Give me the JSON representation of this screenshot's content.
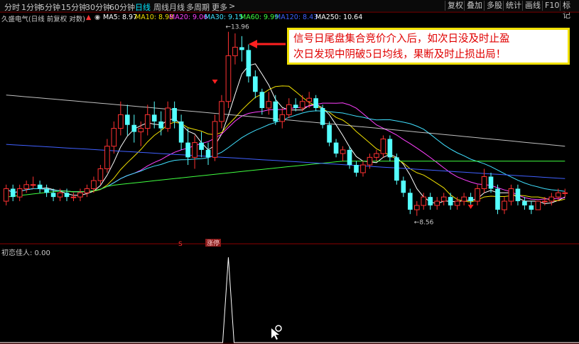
{
  "toolbar": {
    "periods": [
      "分时",
      "1分钟",
      "5分钟",
      "15分钟",
      "30分钟",
      "60分钟",
      "日线",
      "周线",
      "月线",
      "多周期",
      "更多"
    ],
    "active_period": "日线",
    "more_arrow": ">",
    "buttons": [
      "复权",
      "叠加",
      "多股",
      "统计",
      "画线",
      "F10",
      "标记"
    ]
  },
  "stock": {
    "name_line": "久盛电气(日线 前复权 对数)",
    "ma": [
      {
        "label": "MA5: 8.97",
        "color": "#ffffff"
      },
      {
        "label": "MA10: 8.98",
        "color": "#f0e000"
      },
      {
        "label": "MA20: 9.06",
        "color": "#ff40ff"
      },
      {
        "label": "MA30: 9.15",
        "color": "#40e0ff"
      },
      {
        "label": "MA60: 9.99",
        "color": "#40ff40"
      },
      {
        "label": "MA120: 8.43",
        "color": "#4060ff"
      },
      {
        "label": "MA250: 10.64",
        "color": "#ffffff"
      }
    ]
  },
  "annotation": {
    "line1": "信号日尾盘集合竞价介入后，如次日没及时止盈",
    "line2": "次日发现中阴破5日均线，果断及时止损出局！"
  },
  "labels": {
    "high": "13.96",
    "low": "8.56",
    "s_mark": "S",
    "tag": "涨停"
  },
  "indicator": {
    "name": "初恋佳人",
    "value": ": 0.00"
  },
  "colors": {
    "up": "#ff3232",
    "down": "#54ffff",
    "bg": "#000000"
  },
  "chart_data": {
    "type": "candlestick",
    "candles": [
      [
        8.9,
        9.3,
        8.8,
        9.2
      ],
      [
        9.2,
        9.3,
        8.9,
        9.0
      ],
      [
        9.0,
        9.3,
        8.9,
        9.2
      ],
      [
        9.2,
        9.4,
        9.1,
        9.3
      ],
      [
        9.3,
        9.5,
        9.2,
        9.3
      ],
      [
        9.3,
        9.4,
        9.1,
        9.2
      ],
      [
        9.2,
        9.3,
        9.0,
        9.1
      ],
      [
        9.1,
        9.2,
        8.9,
        9.0
      ],
      [
        9.0,
        9.2,
        8.9,
        9.1
      ],
      [
        9.1,
        9.2,
        8.9,
        9.0
      ],
      [
        9.0,
        9.1,
        8.9,
        9.0
      ],
      [
        9.0,
        9.2,
        8.9,
        9.1
      ],
      [
        9.1,
        9.3,
        9.0,
        9.2
      ],
      [
        9.2,
        9.5,
        9.1,
        9.4
      ],
      [
        9.4,
        9.8,
        9.3,
        9.7
      ],
      [
        9.7,
        10.5,
        9.6,
        10.3
      ],
      [
        10.3,
        11.0,
        10.1,
        10.8
      ],
      [
        10.8,
        11.6,
        10.6,
        11.2
      ],
      [
        11.2,
        11.5,
        10.6,
        10.9
      ],
      [
        10.9,
        11.2,
        10.4,
        10.7
      ],
      [
        10.7,
        11.0,
        10.3,
        10.8
      ],
      [
        10.8,
        11.5,
        10.6,
        11.2
      ],
      [
        11.2,
        11.6,
        10.8,
        11.0
      ],
      [
        11.0,
        11.3,
        10.6,
        10.8
      ],
      [
        10.8,
        11.6,
        10.7,
        11.4
      ],
      [
        11.4,
        11.6,
        10.8,
        11.0
      ],
      [
        11.0,
        11.2,
        10.2,
        10.4
      ],
      [
        10.4,
        10.8,
        9.8,
        10.0
      ],
      [
        10.0,
        10.6,
        9.7,
        10.4
      ],
      [
        10.4,
        10.7,
        10.0,
        10.2
      ],
      [
        10.2,
        10.4,
        9.8,
        10.0
      ],
      [
        10.0,
        11.2,
        9.9,
        11.0
      ],
      [
        11.0,
        11.8,
        10.8,
        11.6
      ],
      [
        11.6,
        13.96,
        11.4,
        13.1
      ],
      [
        13.1,
        13.9,
        12.8,
        13.4
      ],
      [
        13.4,
        13.8,
        12.9,
        13.3
      ],
      [
        13.3,
        13.5,
        12.2,
        12.4
      ],
      [
        12.4,
        12.6,
        11.7,
        11.9
      ],
      [
        11.9,
        12.0,
        11.2,
        11.4
      ],
      [
        11.4,
        11.9,
        11.2,
        11.6
      ],
      [
        11.6,
        11.8,
        10.9,
        11.0
      ],
      [
        11.0,
        11.4,
        10.8,
        11.2
      ],
      [
        11.2,
        11.7,
        11.1,
        11.5
      ],
      [
        11.5,
        11.7,
        11.3,
        11.4
      ],
      [
        11.4,
        11.8,
        11.3,
        11.6
      ],
      [
        11.6,
        11.9,
        11.4,
        11.7
      ],
      [
        11.7,
        11.8,
        11.3,
        11.4
      ],
      [
        11.4,
        11.5,
        10.8,
        10.9
      ],
      [
        10.9,
        11.0,
        10.3,
        10.4
      ],
      [
        10.4,
        10.5,
        10.0,
        10.1
      ],
      [
        10.1,
        10.3,
        9.9,
        10.2
      ],
      [
        10.2,
        10.3,
        9.7,
        9.8
      ],
      [
        9.8,
        9.9,
        9.5,
        9.6
      ],
      [
        9.6,
        9.9,
        9.5,
        9.8
      ],
      [
        9.8,
        10.1,
        9.7,
        10.0
      ],
      [
        10.0,
        10.2,
        9.9,
        10.1
      ],
      [
        10.1,
        10.6,
        10.0,
        10.5
      ],
      [
        10.5,
        10.6,
        9.9,
        10.0
      ],
      [
        10.0,
        10.1,
        9.3,
        9.4
      ],
      [
        9.4,
        9.5,
        9.0,
        9.1
      ],
      [
        9.1,
        9.2,
        8.6,
        8.7
      ],
      [
        8.7,
        8.9,
        8.56,
        8.8
      ],
      [
        8.8,
        9.1,
        8.7,
        9.0
      ],
      [
        9.0,
        9.1,
        8.7,
        8.8
      ],
      [
        8.8,
        9.0,
        8.7,
        8.9
      ],
      [
        8.9,
        9.1,
        8.8,
        9.0
      ],
      [
        9.0,
        9.1,
        8.7,
        8.8
      ],
      [
        8.8,
        9.0,
        8.7,
        8.9
      ],
      [
        8.9,
        9.1,
        8.8,
        9.0
      ],
      [
        9.0,
        9.1,
        8.8,
        8.9
      ],
      [
        8.9,
        9.3,
        8.8,
        9.2
      ],
      [
        9.2,
        9.7,
        9.1,
        9.5
      ],
      [
        9.5,
        9.6,
        9.1,
        9.2
      ],
      [
        9.2,
        9.3,
        8.6,
        8.7
      ],
      [
        8.7,
        9.0,
        8.6,
        8.9
      ],
      [
        8.9,
        9.3,
        8.8,
        9.2
      ],
      [
        9.2,
        9.3,
        8.8,
        8.9
      ],
      [
        8.9,
        9.0,
        8.7,
        8.8
      ],
      [
        8.8,
        8.9,
        8.6,
        8.7
      ],
      [
        8.7,
        8.9,
        8.7,
        8.9
      ],
      [
        8.9,
        9.0,
        8.8,
        8.9
      ],
      [
        8.9,
        9.1,
        8.8,
        9.0
      ],
      [
        9.0,
        9.2,
        8.9,
        9.1
      ],
      [
        9.1,
        9.2,
        9.0,
        9.1
      ]
    ],
    "ma_series": [
      {
        "name": "MA5",
        "color": "#ffffff"
      },
      {
        "name": "MA10",
        "color": "#f0e000"
      },
      {
        "name": "MA20",
        "color": "#ff40ff"
      },
      {
        "name": "MA30",
        "color": "#40e0ff"
      },
      {
        "name": "MA60",
        "color": "#40ff40"
      },
      {
        "name": "MA120",
        "color": "#4060ff"
      },
      {
        "name": "MA250",
        "color": "#ffffff"
      }
    ],
    "indicator_peak_index": 33,
    "indicator_range": [
      0,
      1
    ]
  }
}
